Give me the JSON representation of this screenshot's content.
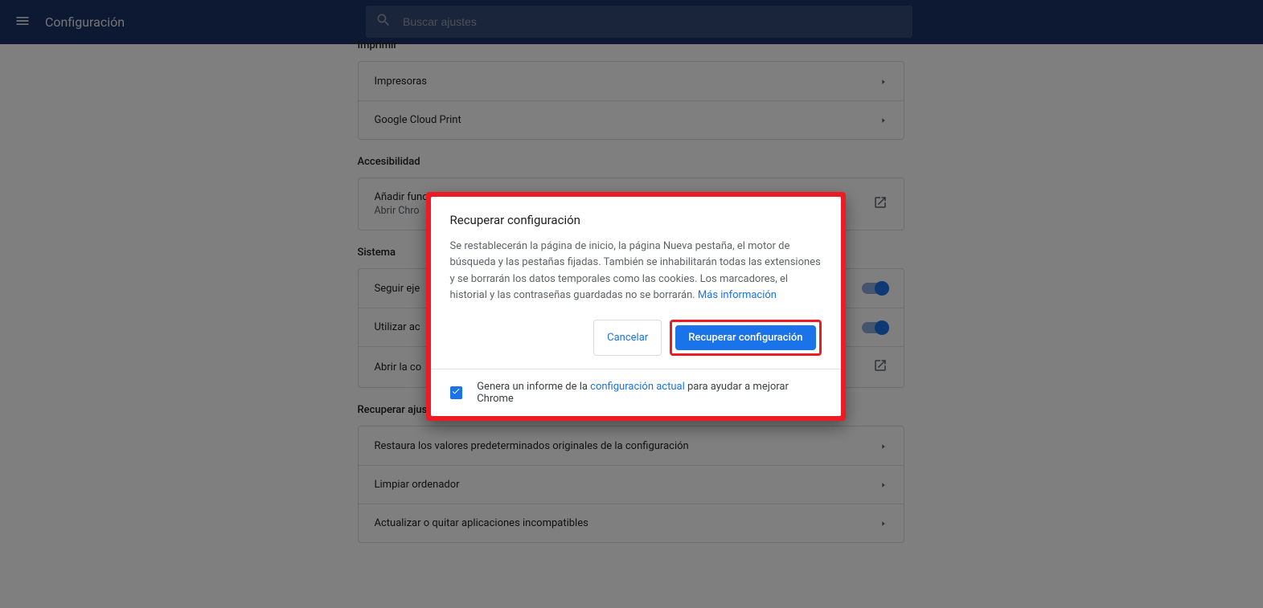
{
  "header": {
    "title": "Configuración",
    "search_placeholder": "Buscar ajustes"
  },
  "sections": {
    "print": {
      "title": "Imprimir",
      "row_printers": "Impresoras",
      "row_cloud": "Google Cloud Print"
    },
    "accessibility": {
      "title": "Accesibilidad",
      "row_main": "Añadir funciones de accesibilidad",
      "row_sub": "Abrir Chro"
    },
    "system": {
      "title": "Sistema",
      "row_background": "Seguir eje",
      "row_hw": "Utilizar ac",
      "row_proxy": "Abrir la co"
    },
    "reset": {
      "title": "Recuperar ajustes y borrar",
      "row_restore": "Restaura los valores predeterminados originales de la configuración",
      "row_cleanup": "Limpiar ordenador",
      "row_update": "Actualizar o quitar aplicaciones incompatibles"
    }
  },
  "dialog": {
    "title": "Recuperar configuración",
    "body": "Se restablecerán la página de inicio, la página Nueva pestaña, el motor de búsqueda y las pestañas fijadas. También se inhabilitarán todas las extensiones y se borrarán los datos temporales como las cookies. Los marcadores, el historial y las contraseñas guardadas no se borrarán. ",
    "more_info": "Más información",
    "cancel": "Cancelar",
    "confirm": "Recuperar configuración",
    "footer_pre": "Genera un informe de la ",
    "footer_link": "configuración actual",
    "footer_post": " para ayudar a mejorar Chrome"
  }
}
